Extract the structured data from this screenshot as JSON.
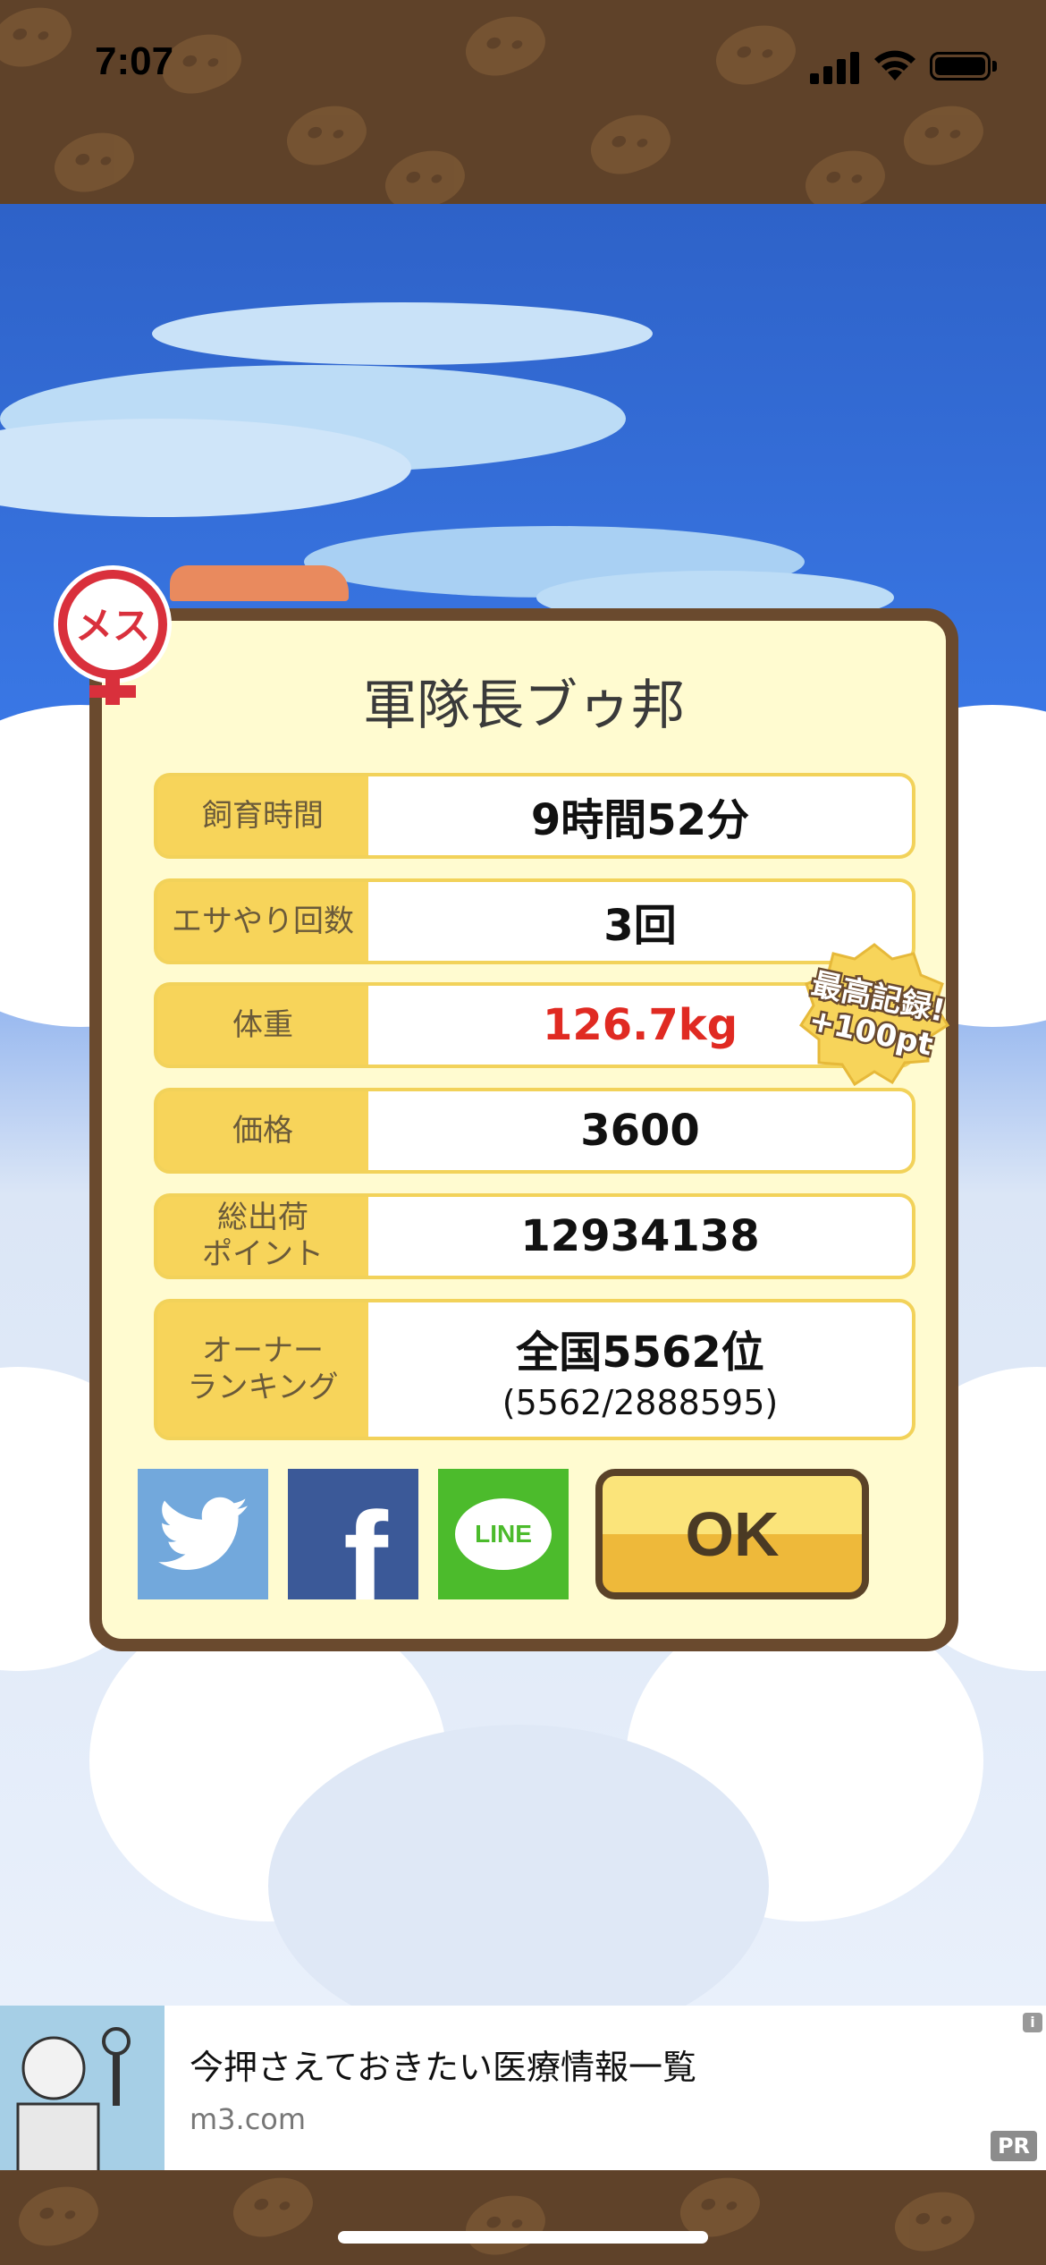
{
  "status_bar": {
    "time": "7:07"
  },
  "dialog": {
    "gender_badge": "メス",
    "title": "軍隊長ブゥ邦",
    "rows": [
      {
        "label": "飼育時間",
        "value": "9時間52分"
      },
      {
        "label": "エサやり回数",
        "value": "3回"
      },
      {
        "label": "体重",
        "value": "126.7kg"
      },
      {
        "label": "価格",
        "value": "3600"
      },
      {
        "label": "総出荷\nポイント",
        "value": "12934138"
      },
      {
        "label": "オーナー\nランキング",
        "value": "全国5562位",
        "sub": "(5562/2888595)"
      }
    ],
    "record_badge": {
      "line1": "最高記録!",
      "line2": "+100pt"
    },
    "share": {
      "twitter": "twitter-icon",
      "facebook": "f",
      "line": "LINE"
    },
    "ok_label": "OK"
  },
  "ad": {
    "title": "今押さえておきたい医療情報一覧",
    "url": "m3.com",
    "pr": "PR",
    "info": "i"
  },
  "colors": {
    "accent_red": "#e02a22",
    "brown": "#6a4a2e",
    "cream": "#fffbd0",
    "gold": "#f7d45a"
  }
}
